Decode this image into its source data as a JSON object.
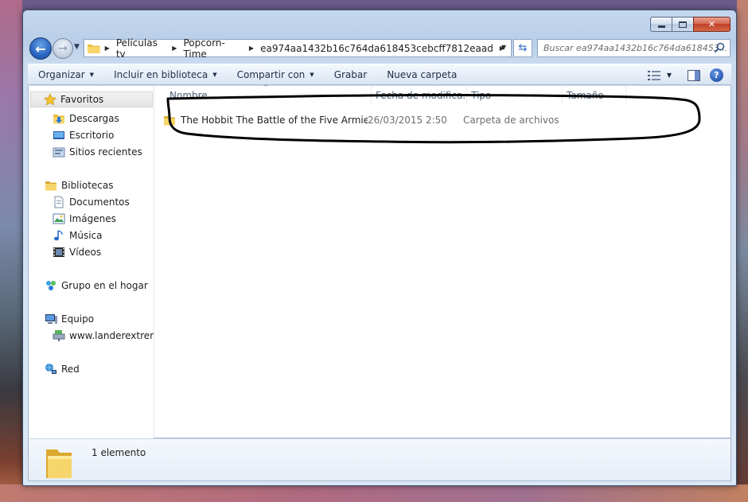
{
  "window": {
    "caption": {
      "minimize": "▭",
      "maximize": "□",
      "close": "✕"
    }
  },
  "address": {
    "crumbs": [
      "Películas tv",
      "Popcorn-Time",
      "ea974aa1432b16c764da618453cebcff7812eaad"
    ],
    "search_placeholder": "Buscar ea974aa1432b16c764da618453..."
  },
  "toolbar": {
    "organize": "Organizar",
    "include_library": "Incluir en biblioteca",
    "share_with": "Compartir con",
    "burn": "Grabar",
    "new_folder": "Nueva carpeta"
  },
  "nav": {
    "favorites": "Favoritos",
    "downloads": "Descargas",
    "desktop": "Escritorio",
    "recent": "Sitios recientes",
    "libraries": "Bibliotecas",
    "documents": "Documentos",
    "pictures": "Imágenes",
    "music": "Música",
    "videos": "Vídeos",
    "homegroup": "Grupo en el hogar",
    "computer": "Equipo",
    "network_drive": "www.landerextremo",
    "network": "Red"
  },
  "columns": {
    "name": "Nombre",
    "date": "Fecha de modifica...",
    "type": "Tipo",
    "size": "Tamaño"
  },
  "files": [
    {
      "name": "The Hobbit The Battle of the Five Armies ...",
      "date": "26/03/2015 2:50",
      "type": "Carpeta de archivos",
      "size": ""
    }
  ],
  "details": {
    "count": "1 elemento"
  },
  "colors": {
    "accent": "#2a66c0",
    "folder": "#f0c850",
    "annotation": "#000000"
  }
}
